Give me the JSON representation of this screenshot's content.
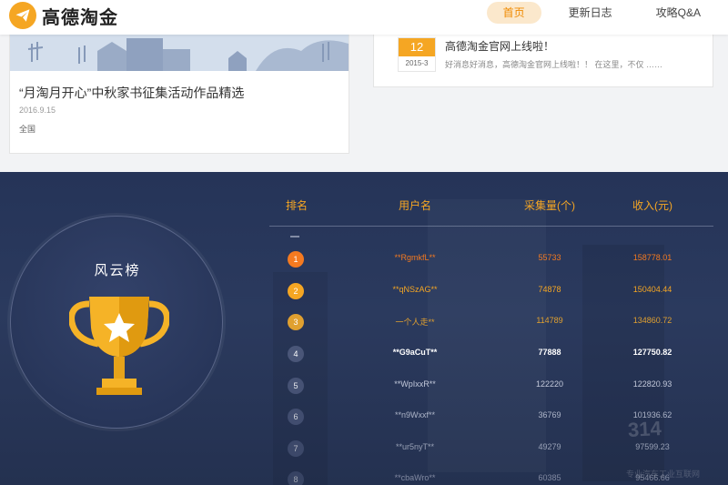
{
  "header": {
    "logo_text": "高德淘金",
    "nav": [
      {
        "label": "首页",
        "active": true
      },
      {
        "label": "更新日志",
        "active": false
      },
      {
        "label": "攻略Q&A",
        "active": false
      }
    ]
  },
  "activity_card": {
    "title": "“月淘月开心”中秋家书征集活动作品精选",
    "date": "2016.9.15",
    "region": "全国"
  },
  "news_card": {
    "day": "12",
    "month": "2015-3",
    "title": "高德淘金官网上线啦！",
    "excerpt": "好消息好消息，高德淘金官网上线啦！！ 在这里，不仅 ……"
  },
  "leaderboard": {
    "title": "风云榜",
    "headers": {
      "rank": "排名",
      "user": "用户名",
      "count": "采集量(个)",
      "income": "收入(元)"
    },
    "rows": [
      {
        "rank": "1",
        "user": "**RgmkfL**",
        "count": "55733",
        "income": "158778.01"
      },
      {
        "rank": "2",
        "user": "**qNSzAG**",
        "count": "74878",
        "income": "150404.44"
      },
      {
        "rank": "3",
        "user": "一个人走**",
        "count": "114789",
        "income": "134860.72"
      },
      {
        "rank": "4",
        "user": "**G9aCuT**",
        "count": "77888",
        "income": "127750.82"
      },
      {
        "rank": "5",
        "user": "**WpIxxR**",
        "count": "122220",
        "income": "122820.93"
      },
      {
        "rank": "6",
        "user": "**n9Wxxf**",
        "count": "36769",
        "income": "101936.62"
      },
      {
        "rank": "7",
        "user": "**ur5nyT**",
        "count": "49279",
        "income": "97599.23"
      },
      {
        "rank": "8",
        "user": "**cbaWro**",
        "count": "60385",
        "income": "95466.66"
      }
    ],
    "colors": {
      "accent": "#f5a623",
      "rank1": "#f47a20",
      "rank2": "#f5a623",
      "rank3": "#e0a030",
      "rank_other": "#4a5678"
    }
  },
  "watermark": {
    "text": "314",
    "sub": "专业汽车工业互联网"
  }
}
